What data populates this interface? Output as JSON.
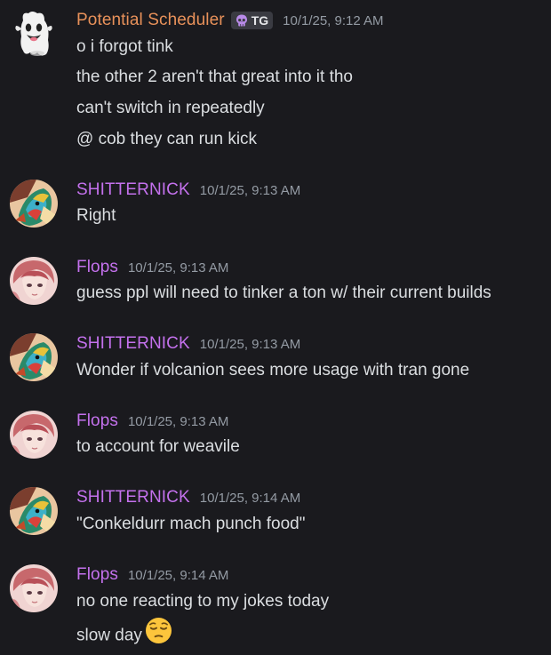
{
  "colors": {
    "background": "#1a1a1e",
    "message_text": "#dbdee1",
    "timestamp": "#949ba4",
    "name_potential_scheduler": "#e8915a",
    "name_shitternick": "#c471ed",
    "name_flops": "#c471ed"
  },
  "messages": [
    {
      "author": "Potential Scheduler",
      "avatar_icon": "ghost-icon",
      "tag": {
        "icon": "skull-icon",
        "label": "TG"
      },
      "timestamp": "10/1/25, 9:12 AM",
      "lines": [
        "o i forgot tink",
        "the other 2 aren't that great into it tho",
        "can't switch in repeatedly",
        "@ cob they can run kick"
      ]
    },
    {
      "author": "SHITTERNICK",
      "avatar_icon": "pokemon-avatar-icon",
      "timestamp": "10/1/25, 9:13 AM",
      "lines": [
        "Right"
      ]
    },
    {
      "author": "Flops",
      "avatar_icon": "anime-portrait-avatar-icon",
      "timestamp": "10/1/25, 9:13 AM",
      "lines": [
        "guess ppl will need to tinker a ton w/ their current builds"
      ]
    },
    {
      "author": "SHITTERNICK",
      "avatar_icon": "pokemon-avatar-icon",
      "timestamp": "10/1/25, 9:13 AM",
      "lines": [
        "Wonder if volcanion sees more usage with tran gone"
      ]
    },
    {
      "author": "Flops",
      "avatar_icon": "anime-portrait-avatar-icon",
      "timestamp": "10/1/25, 9:13 AM",
      "lines": [
        "to account for weavile"
      ]
    },
    {
      "author": "SHITTERNICK",
      "avatar_icon": "pokemon-avatar-icon",
      "timestamp": "10/1/25, 9:14 AM",
      "lines": [
        "\"Conkeldurr mach punch food\""
      ]
    },
    {
      "author": "Flops",
      "avatar_icon": "anime-portrait-avatar-icon",
      "timestamp": "10/1/25, 9:14 AM",
      "lines": [
        "no one reacting to my jokes today",
        "slow day"
      ],
      "trailing_emoji": "pensive-face-emoji-icon"
    }
  ]
}
